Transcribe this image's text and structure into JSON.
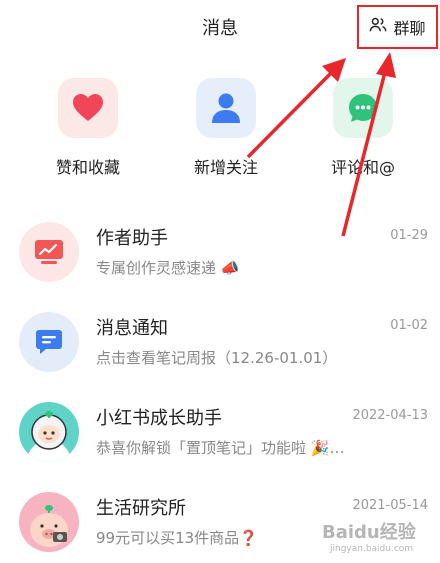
{
  "header": {
    "title": "消息",
    "group_chat_label": "群聊"
  },
  "quick_actions": [
    {
      "label": "赞和收藏",
      "icon": "heart-icon"
    },
    {
      "label": "新增关注",
      "icon": "person-icon"
    },
    {
      "label": "评论和@",
      "icon": "chat-bubble-icon"
    }
  ],
  "messages": [
    {
      "name": "作者助手",
      "preview": "专属创作灵感速递 📣",
      "date": "01-29",
      "avatar": "chart-icon"
    },
    {
      "name": "消息通知",
      "preview": "点击查看笔记周报（12.26-01.01）",
      "date": "01-02",
      "avatar": "message-icon"
    },
    {
      "name": "小红书成长助手",
      "preview": "恭喜你解锁「置顶笔记」功能啦 🎉…",
      "date": "2022-04-13",
      "avatar": "astronaut-avatar"
    },
    {
      "name": "生活研究所",
      "preview": "99元可以买13件商品❓",
      "date": "2021-05-14",
      "avatar": "pig-avatar"
    }
  ],
  "watermark": {
    "main": "Baidu经验",
    "sub": "jingyan.baidu.com"
  },
  "colors": {
    "accent_red": "#e8262c",
    "heart_bg": "#fde8e8",
    "person_bg": "#e6eefb",
    "chat_bg": "#e3f6ec"
  }
}
